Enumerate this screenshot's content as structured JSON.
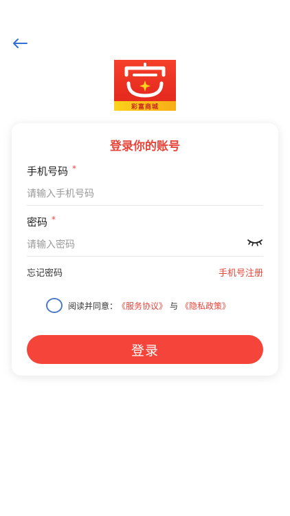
{
  "header": {
    "back_icon": "arrow-left-icon",
    "accent": "#2f6fd6"
  },
  "logo": {
    "glyph": "富",
    "caption": "彩富商城"
  },
  "card": {
    "title": "登录你的账号",
    "phone": {
      "label": "手机号码",
      "required_mark": "*",
      "placeholder": "请输入手机号码"
    },
    "password": {
      "label": "密码",
      "required_mark": "*",
      "placeholder": "请输入密码",
      "toggle_icon": "eye-closed-icon"
    },
    "forgot_password": "忘记密码",
    "register": "手机号注册",
    "agreement": {
      "prefix": "阅读并同意：",
      "service": "《服务协议》",
      "joiner": "与",
      "privacy": "《隐私政策》",
      "checked": false
    },
    "login_button": "登录"
  },
  "colors": {
    "brand_red": "#f5453a",
    "title_red": "#e8443a",
    "radio_blue": "#4a78c8"
  }
}
